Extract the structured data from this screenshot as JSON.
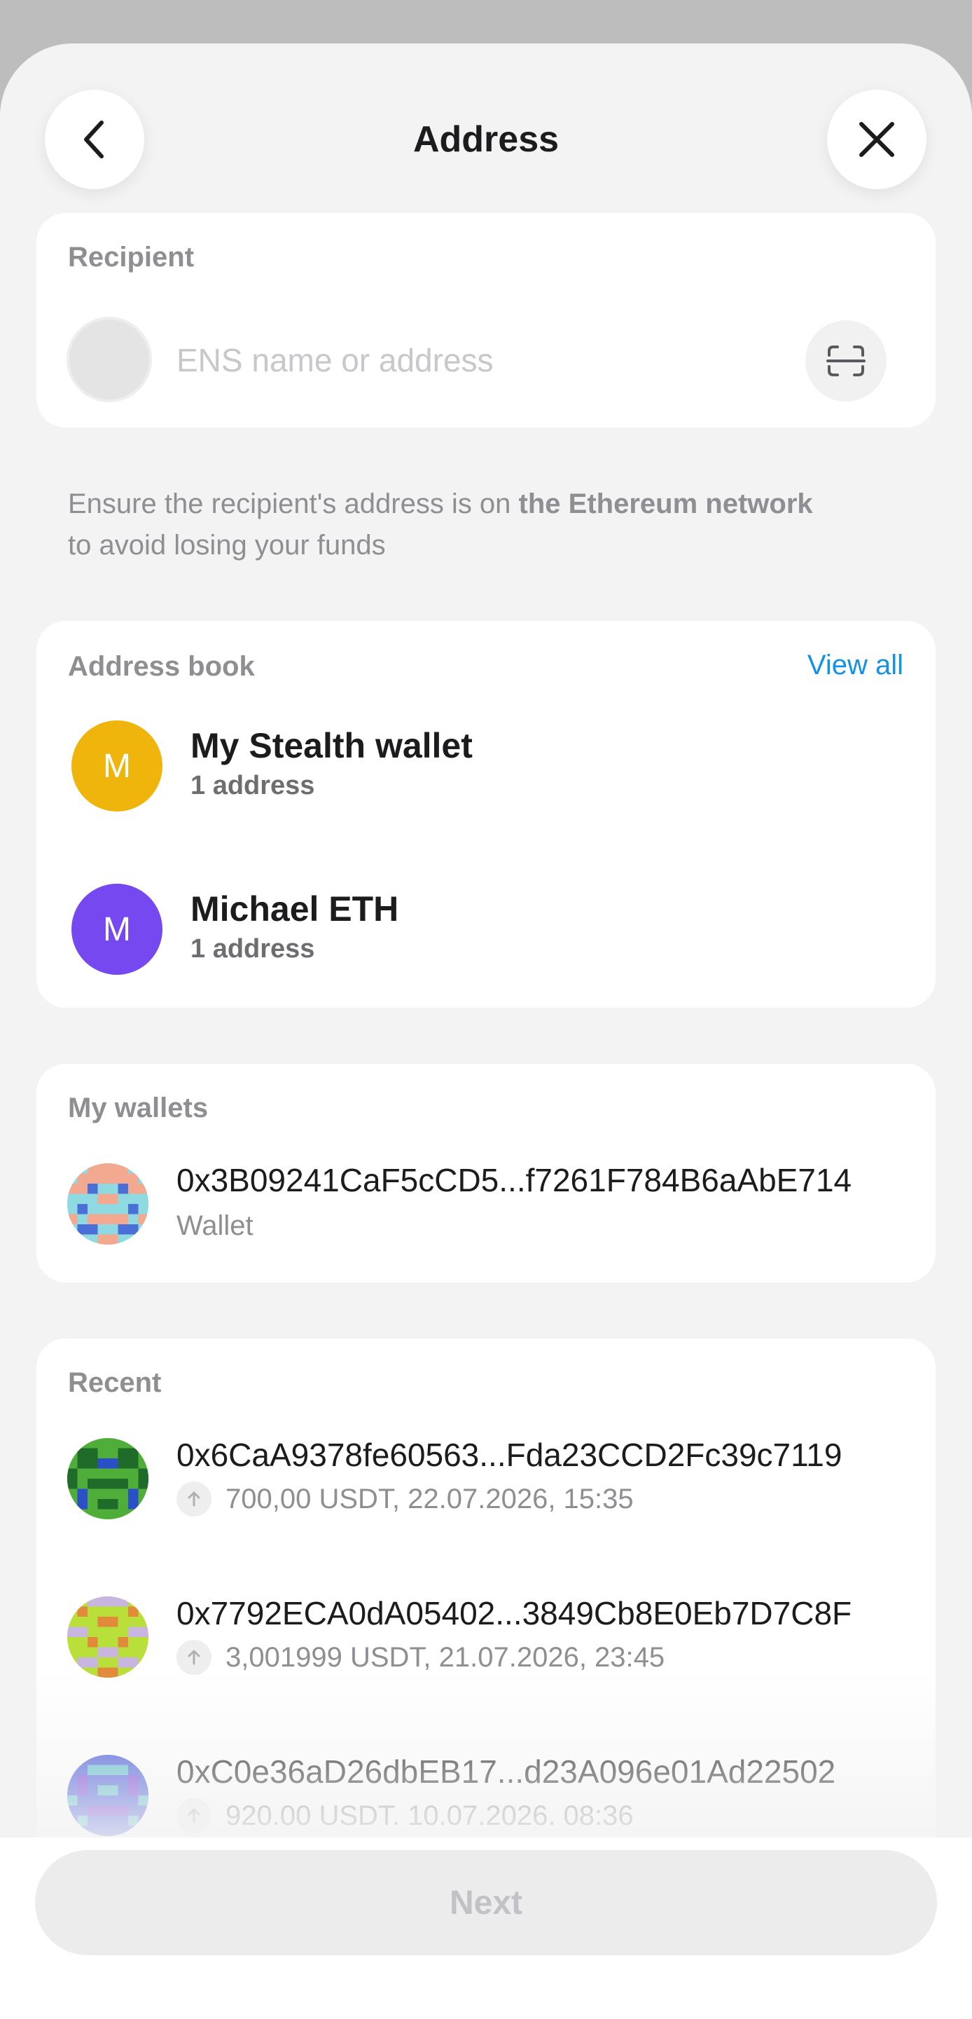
{
  "header": {
    "title": "Address"
  },
  "recipient": {
    "label": "Recipient",
    "placeholder": "ENS name or address"
  },
  "notice": {
    "text_before": "Ensure the recipient's address is on ",
    "network": "the Ethereum network",
    "text_after": " to avoid losing your funds"
  },
  "address_book": {
    "label": "Address book",
    "view_all": "View all",
    "contacts": [
      {
        "initial": "M",
        "name": "My Stealth wallet",
        "sub": "1 address",
        "color": "#efb50c"
      },
      {
        "initial": "M",
        "name": "Michael ETH",
        "sub": "1 address",
        "color": "#7648f0"
      }
    ]
  },
  "my_wallets": {
    "label": "My wallets",
    "items": [
      {
        "address": "0x3B09241CaF5cCD5...f7261F784B6aAbE714",
        "sub": "Wallet"
      }
    ]
  },
  "recent": {
    "label": "Recent",
    "items": [
      {
        "address": "0x6CaA9378fe60563...Fda23CCD2Fc39c7119",
        "detail": "700,00 USDT, 22.07.2026, 15:35"
      },
      {
        "address": "0x7792ECA0dA05402...3849Cb8E0Eb7D7C8F",
        "detail": "3,001999 USDT, 21.07.2026, 23:45"
      },
      {
        "address": "0xC0e36aD26dbEB17...d23A096e01Ad22502",
        "detail": "920.00 USDT. 10.07.2026. 08:36"
      }
    ]
  },
  "footer": {
    "next_label": "Next"
  },
  "colors": {
    "accent_link": "#1492e6",
    "contact_yellow": "#efb50c",
    "contact_purple": "#7648f0"
  },
  "icons": [
    "chevron-left-icon",
    "close-icon",
    "scan-icon",
    "arrow-up-icon"
  ]
}
